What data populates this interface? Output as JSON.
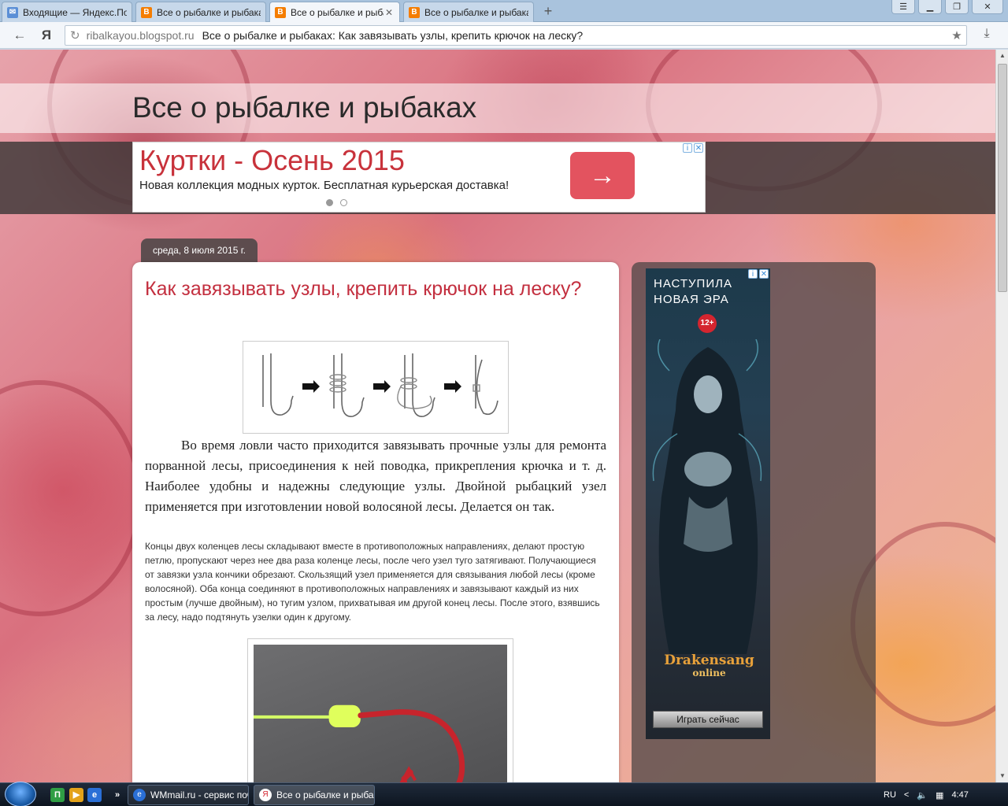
{
  "browser": {
    "tabs": [
      {
        "label": "Входящие — Яндекс.Почта",
        "icon": "mail-icon",
        "active": false
      },
      {
        "label": "Все о рыбалке и рыбаках",
        "icon": "blogger-icon",
        "active": false
      },
      {
        "label": "Все о рыбалке и рыбаках",
        "icon": "blogger-icon",
        "active": true
      },
      {
        "label": "Все о рыбалке и рыбаках",
        "icon": "blogger-icon",
        "active": false
      }
    ],
    "new_tab": "+",
    "yandex_logo": "Я",
    "address": {
      "domain": "ribalkayou.blogspot.ru",
      "page_title": "Все о рыбалке и рыбаках: Как завязывать узлы, крепить крючок на леску?"
    }
  },
  "blog": {
    "title": "Все о рыбалке и рыбаках",
    "top_ad": {
      "title": "Куртки - Осень 2015",
      "description": "Новая коллекция модных курток. Бесплатная курьерская доставка!",
      "button_arrow": "→"
    },
    "post": {
      "date": "среда, 8 июля 2015 г.",
      "title": "Как завязывать узлы, крепить крючок на леску?",
      "paragraph_large": "Во время ловли часто приходится завязывать прочные узлы для ремонта порванной лесы, присоединения к ней поводка, прикрепления крючка и т. д. Наиболее удобны и надежны следующие узлы.  Двойной рыбацкий узел применяется при изготовлении новой волосяной лесы. Делается он так.",
      "paragraph_small": "Концы двух коленцев лесы складывают вместе в противоположных направлениях, делают простую петлю, пропускают через нее два раза коленце лесы, после чего узел туго затягивают. Получающиеся от завязки узла кончики обрезают.  Скользящий узел применяется для связывания любой лесы (кроме волосяной). Оба конца соединяют в противоположных направлениях и завязывают каждый из них простым (лучше двойным), но тугим узлом, прихватывая им другой конец лесы. После этого, взявшись за лесу, надо подтянуть узелки один к другому."
    },
    "side_ad": {
      "headline": "НАСТУПИЛА\nНОВАЯ ЭРА",
      "age_rating": "12+",
      "logo_text": "Drakensang",
      "logo_sub": "online",
      "button": "Играть сейчас"
    }
  },
  "taskbar": {
    "items": [
      {
        "label": "WMmail.ru - сервис почтовых рассылок",
        "active": false
      },
      {
        "label": "Все о рыбалке и рыбаках",
        "active": true
      }
    ],
    "overflow": "»",
    "language": "RU",
    "tray_chevron": "<",
    "clock": "4:47"
  },
  "colors": {
    "post_title": "#c32f3f",
    "ad_title": "#c8323b",
    "ad_button": "#e3535f"
  }
}
